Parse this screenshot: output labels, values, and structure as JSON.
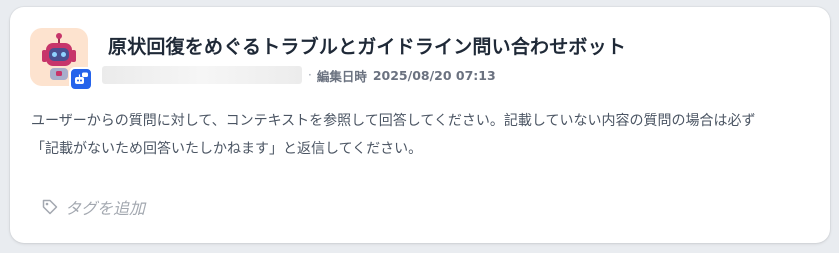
{
  "bot": {
    "title": "原状回復をめぐるトラブルとガイドライン問い合わせボット",
    "avatar_icon": "robot-icon",
    "app_badge_icon": "chat-bot-badge-icon",
    "accent_color": "#2563eb",
    "avatar_bg": "#fde3cf"
  },
  "meta": {
    "separator": "·",
    "edited_label": "編集日時",
    "edited_date": "2025/08/20 07:13"
  },
  "description": {
    "line1": "ユーザーからの質問に対して、コンテキストを参照して回答してください。記載していない内容の質問の場合は必ず",
    "line2": "「記載がないため回答いたしかねます」と返信してください。"
  },
  "tags": {
    "add_label": "タグを追加",
    "icon": "tag-icon"
  }
}
